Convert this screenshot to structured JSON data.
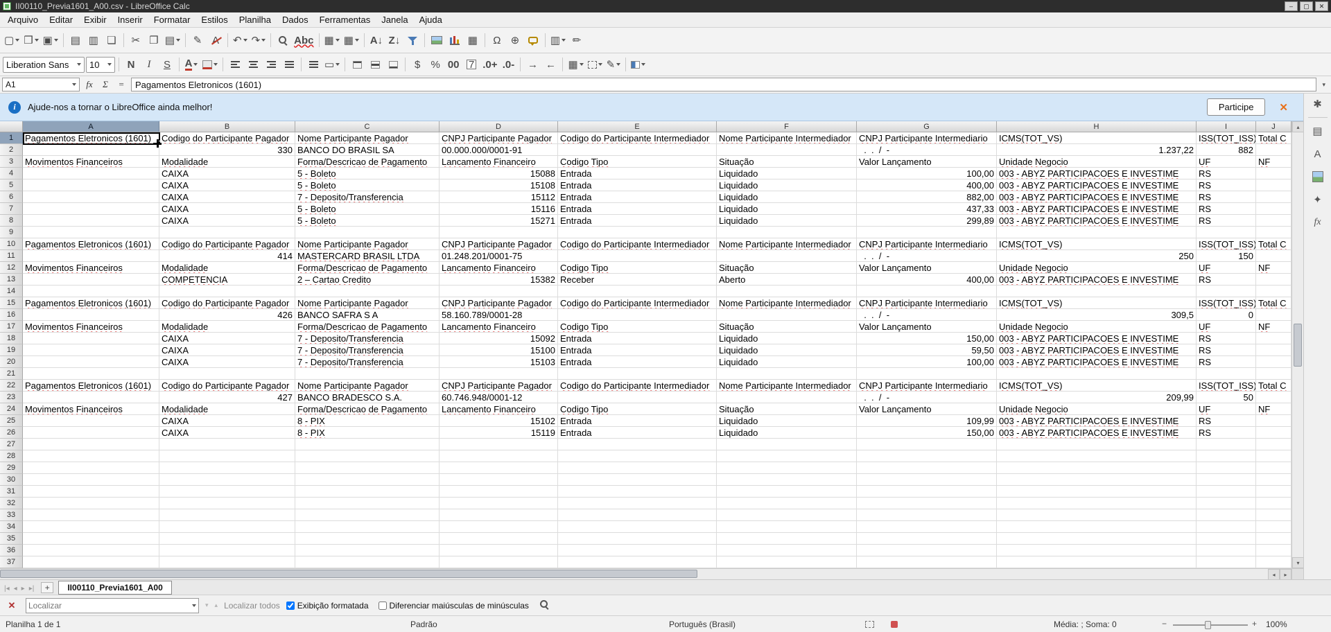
{
  "window": {
    "title": "II00110_Previa1601_A00.csv - LibreOffice Calc",
    "minimize": "–",
    "maximize": "▢",
    "close": "✕"
  },
  "icons": {
    "up": "▴",
    "down": "▾",
    "left": "◂",
    "right": "▸"
  },
  "menubar": [
    "Arquivo",
    "Editar",
    "Exibir",
    "Inserir",
    "Formatar",
    "Estilos",
    "Planilha",
    "Dados",
    "Ferramentas",
    "Janela",
    "Ajuda"
  ],
  "toolbar_std": [
    {
      "n": "new-document",
      "g": "▢",
      "dd": true
    },
    {
      "n": "open",
      "g": "❒",
      "c": "amber",
      "dd": true
    },
    {
      "n": "save",
      "g": "▣",
      "c": "blue",
      "dd": true
    },
    {
      "sep": true
    },
    {
      "n": "export-pdf",
      "g": "▤",
      "c": "red"
    },
    {
      "n": "print",
      "g": "▥"
    },
    {
      "n": "print-preview",
      "g": "❏"
    },
    {
      "sep": true
    },
    {
      "n": "cut",
      "g": "✂"
    },
    {
      "n": "copy",
      "g": "❐"
    },
    {
      "n": "paste",
      "g": "▤",
      "dd": true
    },
    {
      "sep": true
    },
    {
      "n": "clone-formatting",
      "g": "✎",
      "c": "amber"
    },
    {
      "n": "clear-formatting",
      "g": "A",
      "c": "strike"
    },
    {
      "sep": true
    },
    {
      "n": "undo",
      "g": "↶",
      "c": "amber",
      "dd": true
    },
    {
      "n": "redo",
      "g": "↷",
      "c": "green",
      "dd": true
    },
    {
      "sep": true
    },
    {
      "n": "find-and-replace",
      "g": "",
      "c": "mag"
    },
    {
      "n": "spelling",
      "g": "Abc",
      "c": "spell"
    },
    {
      "sep": true
    },
    {
      "n": "insert-rows",
      "g": "▦",
      "dd": true
    },
    {
      "n": "insert-columns",
      "g": "▦",
      "dd": true
    },
    {
      "sep": true
    },
    {
      "n": "sort-ascending",
      "g": "A↓",
      "c": "sort"
    },
    {
      "n": "sort-descending",
      "g": "Z↓",
      "c": "sort"
    },
    {
      "n": "autofilter",
      "g": "",
      "c": "funnel"
    },
    {
      "sep": true
    },
    {
      "n": "insert-image",
      "g": "",
      "c": "image"
    },
    {
      "n": "insert-chart",
      "g": "",
      "c": "chart"
    },
    {
      "n": "insert-pivot-table",
      "g": "▦",
      "c": "blue"
    },
    {
      "sep": true
    },
    {
      "n": "insert-special-character",
      "g": "Ω"
    },
    {
      "n": "insert-hyperlink",
      "g": "⊕",
      "c": "blue"
    },
    {
      "n": "insert-comment",
      "g": "",
      "c": "bubble"
    },
    {
      "sep": true
    },
    {
      "n": "freeze-rows-columns",
      "g": "▥",
      "dd": true
    },
    {
      "n": "show-draw-functions",
      "g": "✏"
    }
  ],
  "toolbar_fmt": [
    {
      "combo": true,
      "n": "font-name",
      "v": "Liberation Sans",
      "w": 118
    },
    {
      "combo": true,
      "n": "font-size",
      "v": "10",
      "w": 42
    },
    {
      "sep": true
    },
    {
      "n": "bold",
      "g": "N",
      "c": "bold"
    },
    {
      "n": "italic",
      "g": "I",
      "c": "italic"
    },
    {
      "n": "underline",
      "g": "S",
      "c": "underl"
    },
    {
      "sep": true
    },
    {
      "n": "font-color",
      "g": "A",
      "c": "fcolor",
      "dd": true
    },
    {
      "n": "highlighting-color",
      "g": "",
      "c": "hcolor",
      "dd": true
    },
    {
      "sep": true
    },
    {
      "n": "align-left",
      "g": "",
      "c": "al ll"
    },
    {
      "n": "align-center",
      "g": "",
      "c": "al lc"
    },
    {
      "n": "align-right",
      "g": "",
      "c": "al lr"
    },
    {
      "n": "justified",
      "g": "",
      "c": "al lj"
    },
    {
      "sep": true
    },
    {
      "n": "wrap-text",
      "g": "",
      "c": "al lj"
    },
    {
      "n": "merge-cells",
      "g": "▭",
      "dd": true
    },
    {
      "sep": true
    },
    {
      "n": "align-top",
      "g": "",
      "c": "vt"
    },
    {
      "n": "center-vertically",
      "g": "",
      "c": "vm"
    },
    {
      "n": "align-bottom",
      "g": "",
      "c": "vb"
    },
    {
      "sep": true
    },
    {
      "n": "format-currency",
      "g": "$",
      "c": "green"
    },
    {
      "n": "format-percent",
      "g": "%"
    },
    {
      "n": "format-number",
      "g": "00",
      "c": "small"
    },
    {
      "n": "format-date",
      "g": "7",
      "c": "datebox"
    },
    {
      "n": "add-decimal",
      "g": ".0+",
      "c": "small"
    },
    {
      "n": "delete-decimal",
      "g": ".0-",
      "c": "small reddish"
    },
    {
      "sep": true
    },
    {
      "n": "increase-indent",
      "g": "→"
    },
    {
      "n": "decrease-indent",
      "g": "←"
    },
    {
      "sep": true
    },
    {
      "n": "borders",
      "g": "▦",
      "dd": true
    },
    {
      "n": "border-style",
      "g": "",
      "c": "dashbox",
      "dd": true
    },
    {
      "n": "border-color",
      "g": "✎",
      "c": "blue",
      "dd": true
    },
    {
      "sep": true
    },
    {
      "n": "conditional-formatting",
      "g": "",
      "c": "halfbox",
      "dd": true
    }
  ],
  "formula_bar": {
    "cell_reference": "A1",
    "content": "Pagamentos Eletronicos (1601)",
    "expand": "▾",
    "buttons": [
      {
        "n": "function-wizard",
        "g": "fx"
      },
      {
        "n": "select-function",
        "g": "Σ"
      },
      {
        "n": "formula",
        "g": "="
      }
    ]
  },
  "infobar": {
    "icon": "i",
    "message": "Ajude-nos a tornar o LibreOffice ainda melhor!",
    "button": "Participe",
    "close": "✕"
  },
  "sheet": {
    "columns": [
      "A",
      "B",
      "C",
      "D",
      "E",
      "F",
      "G",
      "H",
      "I",
      "J"
    ],
    "selection": {
      "row": 1,
      "col": "A"
    },
    "rows": [
      [
        {
          "v": "Pagamentos Eletronicos (1601)",
          "w": 1
        },
        {
          "v": "Codigo do Participante Pagador",
          "w": 1
        },
        {
          "v": "Nome Participante Pagador",
          "w": 1
        },
        {
          "v": "CNPJ Participante Pagador",
          "w": 1
        },
        {
          "v": "Codigo do Participante Intermediador",
          "w": 1
        },
        {
          "v": "Nome Participante Intermediador",
          "w": 1
        },
        {
          "v": "CNPJ Participante Intermediario",
          "w": 1
        },
        {
          "v": "ICMS(TOT_VS)",
          "w": 1
        },
        {
          "v": "ISS(TOT_ISS)",
          "w": 1
        },
        {
          "v": "Total C",
          "w": 1
        }
      ],
      [
        null,
        {
          "v": "330",
          "a": "r"
        },
        "BANCO DO BRASIL SA",
        "00.000.000/0001-91",
        null,
        null,
        "  .  .  /  -",
        {
          "v": "1.237,22",
          "a": "r"
        },
        {
          "v": "882",
          "a": "r"
        },
        null
      ],
      [
        {
          "v": "Movimentos Financeiros",
          "w": 1
        },
        {
          "v": "Modalidade",
          "w": 1
        },
        {
          "v": "Forma/Descricao de Pagamento",
          "w": 1
        },
        {
          "v": "Lancamento Financeiro",
          "w": 1
        },
        {
          "v": "Codigo Tipo",
          "w": 1
        },
        "Situação",
        "Valor Lançamento",
        {
          "v": "Unidade Negocio",
          "w": 1
        },
        {
          "v": "UF",
          "w": 1
        },
        {
          "v": "NF",
          "w": 1
        }
      ],
      [
        null,
        "CAIXA",
        {
          "v": "5 - Boleto",
          "w": 1
        },
        {
          "v": "15088",
          "a": "r"
        },
        "Entrada",
        "Liquidado",
        {
          "v": "100,00",
          "a": "r"
        },
        {
          "v": "003 - ABYZ PARTICIPACOES E INVESTIME",
          "w": 1
        },
        "RS",
        null
      ],
      [
        null,
        "CAIXA",
        {
          "v": "5 - Boleto",
          "w": 1
        },
        {
          "v": "15108",
          "a": "r"
        },
        "Entrada",
        "Liquidado",
        {
          "v": "400,00",
          "a": "r"
        },
        {
          "v": "003 - ABYZ PARTICIPACOES E INVESTIME",
          "w": 1
        },
        "RS",
        null
      ],
      [
        null,
        "CAIXA",
        {
          "v": "7 - Deposito/Transferencia",
          "w": 1
        },
        {
          "v": "15112",
          "a": "r"
        },
        "Entrada",
        "Liquidado",
        {
          "v": "882,00",
          "a": "r"
        },
        {
          "v": "003 - ABYZ PARTICIPACOES E INVESTIME",
          "w": 1
        },
        "RS",
        null
      ],
      [
        null,
        "CAIXA",
        {
          "v": "5 - Boleto",
          "w": 1
        },
        {
          "v": "15116",
          "a": "r"
        },
        "Entrada",
        "Liquidado",
        {
          "v": "437,33",
          "a": "r"
        },
        {
          "v": "003 - ABYZ PARTICIPACOES E INVESTIME",
          "w": 1
        },
        "RS",
        null
      ],
      [
        null,
        "CAIXA",
        {
          "v": "5 - Boleto",
          "w": 1
        },
        {
          "v": "15271",
          "a": "r"
        },
        "Entrada",
        "Liquidado",
        {
          "v": "299,89",
          "a": "r"
        },
        {
          "v": "003 - ABYZ PARTICIPACOES E INVESTIME",
          "w": 1
        },
        "RS",
        null
      ],
      [],
      [
        {
          "v": "Pagamentos Eletronicos (1601)",
          "w": 1
        },
        {
          "v": "Codigo do Participante Pagador",
          "w": 1
        },
        {
          "v": "Nome Participante Pagador",
          "w": 1
        },
        {
          "v": "CNPJ Participante Pagador",
          "w": 1
        },
        {
          "v": "Codigo do Participante Intermediador",
          "w": 1
        },
        {
          "v": "Nome Participante Intermediador",
          "w": 1
        },
        {
          "v": "CNPJ Participante Intermediario",
          "w": 1
        },
        {
          "v": "ICMS(TOT_VS)",
          "w": 1
        },
        {
          "v": "ISS(TOT_ISS)",
          "w": 1
        },
        {
          "v": "Total C",
          "w": 1
        }
      ],
      [
        null,
        {
          "v": "414",
          "a": "r"
        },
        {
          "v": "MASTERCARD BRASIL LTDA",
          "w": 1
        },
        "01.248.201/0001-75",
        null,
        null,
        "  .  .  /  -",
        {
          "v": "250",
          "a": "r"
        },
        {
          "v": "150",
          "a": "r"
        },
        null
      ],
      [
        {
          "v": "Movimentos Financeiros",
          "w": 1
        },
        {
          "v": "Modalidade",
          "w": 1
        },
        {
          "v": "Forma/Descricao de Pagamento",
          "w": 1
        },
        {
          "v": "Lancamento Financeiro",
          "w": 1
        },
        {
          "v": "Codigo Tipo",
          "w": 1
        },
        "Situação",
        "Valor Lançamento",
        {
          "v": "Unidade Negocio",
          "w": 1
        },
        {
          "v": "UF",
          "w": 1
        },
        {
          "v": "NF",
          "w": 1
        }
      ],
      [
        null,
        {
          "v": "COMPETENCIA",
          "w": 1
        },
        {
          "v": "2 – Cartao Credito",
          "w": 1
        },
        {
          "v": "15382",
          "a": "r"
        },
        "Receber",
        "Aberto",
        {
          "v": "400,00",
          "a": "r"
        },
        {
          "v": "003 - ABYZ PARTICIPACOES E INVESTIME",
          "w": 1
        },
        "RS",
        null
      ],
      [],
      [
        {
          "v": "Pagamentos Eletronicos (1601)",
          "w": 1
        },
        {
          "v": "Codigo do Participante Pagador",
          "w": 1
        },
        {
          "v": "Nome Participante Pagador",
          "w": 1
        },
        {
          "v": "CNPJ Participante Pagador",
          "w": 1
        },
        {
          "v": "Codigo do Participante Intermediador",
          "w": 1
        },
        {
          "v": "Nome Participante Intermediador",
          "w": 1
        },
        {
          "v": "CNPJ Participante Intermediario",
          "w": 1
        },
        {
          "v": "ICMS(TOT_VS)",
          "w": 1
        },
        {
          "v": "ISS(TOT_ISS)",
          "w": 1
        },
        {
          "v": "Total C",
          "w": 1
        }
      ],
      [
        null,
        {
          "v": "426",
          "a": "r"
        },
        "BANCO SAFRA S A",
        "58.160.789/0001-28",
        null,
        null,
        "  .  .  /  -",
        {
          "v": "309,5",
          "a": "r"
        },
        {
          "v": "0",
          "a": "r"
        },
        null
      ],
      [
        {
          "v": "Movimentos Financeiros",
          "w": 1
        },
        {
          "v": "Modalidade",
          "w": 1
        },
        {
          "v": "Forma/Descricao de Pagamento",
          "w": 1
        },
        {
          "v": "Lancamento Financeiro",
          "w": 1
        },
        {
          "v": "Codigo Tipo",
          "w": 1
        },
        "Situação",
        "Valor Lançamento",
        {
          "v": "Unidade Negocio",
          "w": 1
        },
        {
          "v": "UF",
          "w": 1
        },
        {
          "v": "NF",
          "w": 1
        }
      ],
      [
        null,
        "CAIXA",
        {
          "v": "7 - Deposito/Transferencia",
          "w": 1
        },
        {
          "v": "15092",
          "a": "r"
        },
        "Entrada",
        "Liquidado",
        {
          "v": "150,00",
          "a": "r"
        },
        {
          "v": "003 - ABYZ PARTICIPACOES E INVESTIME",
          "w": 1
        },
        "RS",
        null
      ],
      [
        null,
        "CAIXA",
        {
          "v": "7 - Deposito/Transferencia",
          "w": 1
        },
        {
          "v": "15100",
          "a": "r"
        },
        "Entrada",
        "Liquidado",
        {
          "v": "59,50",
          "a": "r"
        },
        {
          "v": "003 - ABYZ PARTICIPACOES E INVESTIME",
          "w": 1
        },
        "RS",
        null
      ],
      [
        null,
        "CAIXA",
        {
          "v": "7 - Deposito/Transferencia",
          "w": 1
        },
        {
          "v": "15103",
          "a": "r"
        },
        "Entrada",
        "Liquidado",
        {
          "v": "100,00",
          "a": "r"
        },
        {
          "v": "003 - ABYZ PARTICIPACOES E INVESTIME",
          "w": 1
        },
        "RS",
        null
      ],
      [],
      [
        {
          "v": "Pagamentos Eletronicos (1601)",
          "w": 1
        },
        {
          "v": "Codigo do Participante Pagador",
          "w": 1
        },
        {
          "v": "Nome Participante Pagador",
          "w": 1
        },
        {
          "v": "CNPJ Participante Pagador",
          "w": 1
        },
        {
          "v": "Codigo do Participante Intermediador",
          "w": 1
        },
        {
          "v": "Nome Participante Intermediador",
          "w": 1
        },
        {
          "v": "CNPJ Participante Intermediario",
          "w": 1
        },
        {
          "v": "ICMS(TOT_VS)",
          "w": 1
        },
        {
          "v": "ISS(TOT_ISS)",
          "w": 1
        },
        {
          "v": "Total C",
          "w": 1
        }
      ],
      [
        null,
        {
          "v": "427",
          "a": "r"
        },
        "BANCO BRADESCO S.A.",
        "60.746.948/0001-12",
        null,
        null,
        "  .  .  /  -",
        {
          "v": "209,99",
          "a": "r"
        },
        {
          "v": "50",
          "a": "r"
        },
        null
      ],
      [
        {
          "v": "Movimentos Financeiros",
          "w": 1
        },
        {
          "v": "Modalidade",
          "w": 1
        },
        {
          "v": "Forma/Descricao de Pagamento",
          "w": 1
        },
        {
          "v": "Lancamento Financeiro",
          "w": 1
        },
        {
          "v": "Codigo Tipo",
          "w": 1
        },
        "Situação",
        "Valor Lançamento",
        {
          "v": "Unidade Negocio",
          "w": 1
        },
        {
          "v": "UF",
          "w": 1
        },
        {
          "v": "NF",
          "w": 1
        }
      ],
      [
        null,
        "CAIXA",
        {
          "v": "8 - PIX",
          "w": 1
        },
        {
          "v": "15102",
          "a": "r"
        },
        "Entrada",
        "Liquidado",
        {
          "v": "109,99",
          "a": "r"
        },
        {
          "v": "003 - ABYZ PARTICIPACOES E INVESTIME",
          "w": 1
        },
        "RS",
        null
      ],
      [
        null,
        "CAIXA",
        {
          "v": "8 - PIX",
          "w": 1
        },
        {
          "v": "15119",
          "a": "r"
        },
        "Entrada",
        "Liquidado",
        {
          "v": "150,00",
          "a": "r"
        },
        {
          "v": "003 - ABYZ PARTICIPACOES E INVESTIME",
          "w": 1
        },
        "RS",
        null
      ],
      [],
      [],
      [],
      [],
      [],
      [],
      [],
      [],
      [],
      [],
      []
    ]
  },
  "sidebar": {
    "icons": [
      {
        "n": "sidebar-settings",
        "g": "✱"
      },
      {
        "n": "properties",
        "g": "▤"
      },
      {
        "n": "styles",
        "g": "A"
      },
      {
        "n": "gallery",
        "g": "",
        "c": "image"
      },
      {
        "n": "navigator",
        "g": "✦"
      },
      {
        "n": "functions",
        "g": "fx",
        "c": "fx"
      }
    ]
  },
  "tabbar": {
    "nav": [
      {
        "n": "first-sheet",
        "g": "|◂"
      },
      {
        "n": "previous-sheet",
        "g": "◂"
      },
      {
        "n": "next-sheet",
        "g": "▸"
      },
      {
        "n": "last-sheet",
        "g": "▸|"
      }
    ],
    "add": "+",
    "sheet_name": "II00110_Previa1601_A00"
  },
  "findbar": {
    "close": "✕",
    "placeholder": "Localizar",
    "next": "▾",
    "previous": "▴",
    "find_all": "Localizar todos",
    "options": [
      {
        "label": "Exibição formatada",
        "checked": true
      },
      {
        "label": "Diferenciar maiúsculas de minúsculas",
        "checked": false
      }
    ]
  },
  "statusbar": {
    "sheet_info": "Planilha 1 de 1",
    "page_style": "Padrão",
    "language": "Português (Brasil)",
    "stats": "Média: ; Soma: 0",
    "zoom_minus": "−",
    "zoom_plus": "+",
    "zoom": "100%"
  }
}
